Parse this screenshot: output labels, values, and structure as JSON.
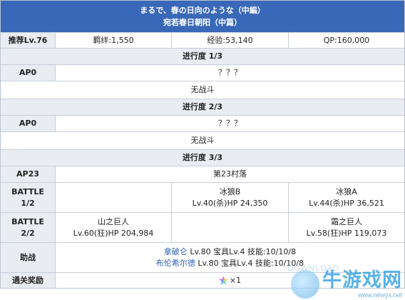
{
  "title": {
    "jp": "まるで、春の日向のような（中編）",
    "cn": "宛若春日朝阳（中篇）"
  },
  "header": {
    "recommend_label": "推荐Lv.76",
    "bond": "羁绊:1,550",
    "exp": "经验:53,140",
    "qp": "QP:160,000"
  },
  "progress": [
    {
      "label": "进行度 1/3",
      "ap": "AP0",
      "ap_value": "？？？",
      "battle": "无战斗"
    },
    {
      "label": "进行度 2/3",
      "ap": "AP0",
      "ap_value": "？？？",
      "battle": "无战斗"
    },
    {
      "label": "进行度 3/3",
      "ap": "AP23",
      "ap_value": "第23村落"
    }
  ],
  "battles": [
    {
      "label_line1": "BATTLE",
      "label_line2": "1/2",
      "enemies": [
        {
          "name": "",
          "stats": ""
        },
        {
          "name": "冰狼B",
          "stats": "Lv.40(杀)HP 24,350"
        },
        {
          "name": "冰狼A",
          "stats": "Lv.44(杀)HP 36,521"
        }
      ]
    },
    {
      "label_line1": "BATTLE",
      "label_line2": "2/2",
      "enemies": [
        {
          "name": "山之巨人",
          "stats": "Lv.60(狂)HP 204,984"
        },
        {
          "name": "",
          "stats": ""
        },
        {
          "name": "霜之巨人",
          "stats": "Lv.58(狂)HP 119,073"
        }
      ]
    }
  ],
  "support": {
    "label": "助战",
    "entries": [
      {
        "name": "拿破仑",
        "details": " Lv.80 宝具Lv.4 技能:10/10/8"
      },
      {
        "name": "布伦希尔德",
        "details": " Lv.80 宝具Lv.4 技能:10/10/8"
      }
    ]
  },
  "reward": {
    "label": "通关奖励",
    "icon": "saint-quartz-icon",
    "count": "×1"
  },
  "watermark": {
    "main": "牛游戏网",
    "url": "www.newyx.net",
    "ghost": "DOWNLOAD"
  },
  "colors": {
    "title_bg": "#3a68b8",
    "header_bg": "#e9ecf1",
    "link": "#2a5db0",
    "border": "#c8cfd9"
  }
}
